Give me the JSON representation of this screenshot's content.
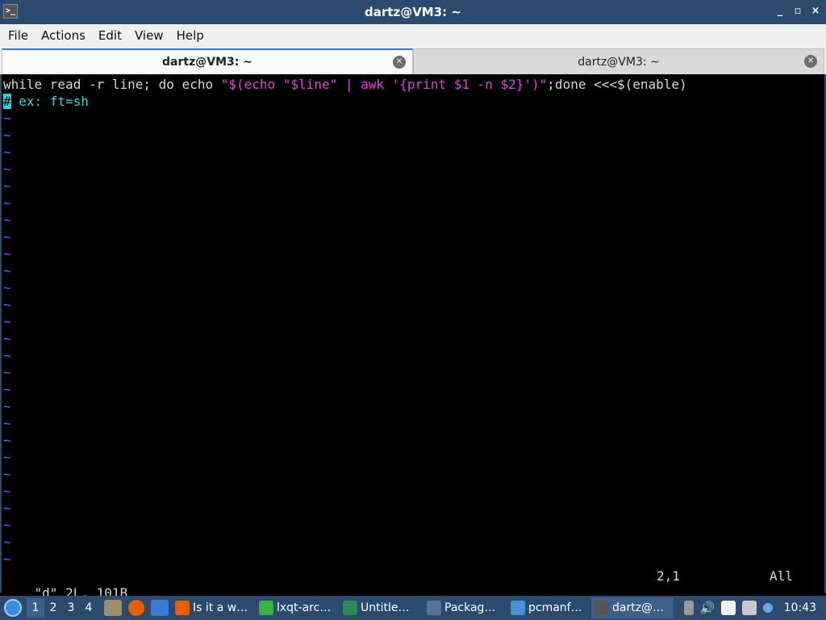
{
  "window": {
    "title": "dartz@VM3: ~",
    "icon_name": "terminal-icon",
    "controls": [
      "_",
      "▫",
      "×"
    ]
  },
  "menu": [
    "File",
    "Actions",
    "Edit",
    "View",
    "Help"
  ],
  "tabs": [
    {
      "label": "dartz@VM3: ~",
      "active": true
    },
    {
      "label": "dartz@VM3: ~",
      "active": false
    }
  ],
  "editor": {
    "line1": {
      "seg1": "while read -r line; do echo ",
      "seg2": "\"$(echo \"$line\" | awk '{print $1 -n $2}')\"",
      "seg3": ";done <<<$(enable)"
    },
    "line2": {
      "cursor_char": "#",
      "rest": " ex: ft=sh"
    },
    "tilde": "~",
    "status": {
      "file": "\"d\" 2L, 101B",
      "position": "2,1",
      "scroll": "All"
    }
  },
  "taskbar": {
    "desktops": [
      "1",
      "2",
      "3",
      "4"
    ],
    "active_desktop": "1",
    "tasks": [
      {
        "label": "Is it a w…",
        "icon": "firefox-icon",
        "color": "#e66000"
      },
      {
        "label": "lxqt-arc…",
        "icon": "archive-icon",
        "color": "#3cb043"
      },
      {
        "label": "Untitle…",
        "icon": "spreadsheet-icon",
        "color": "#2e8b57"
      },
      {
        "label": "Packag…",
        "icon": "package-icon",
        "color": "#5a6f9a"
      },
      {
        "label": "pcmanf…",
        "icon": "folder-icon",
        "color": "#4a90d9"
      },
      {
        "label": "dartz@…",
        "icon": "terminal-icon",
        "color": "#555555"
      }
    ],
    "clock": "10:43"
  }
}
